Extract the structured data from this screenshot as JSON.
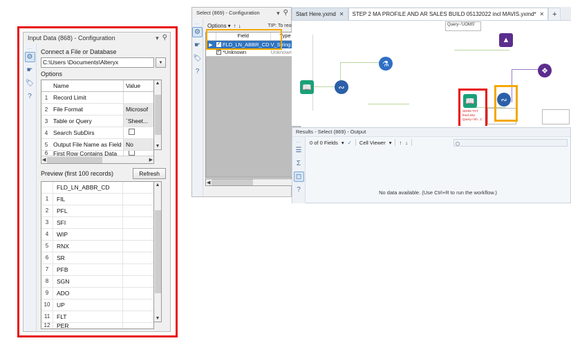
{
  "input_panel": {
    "title": "Input Data (868) - Configuration",
    "section_connect": "Connect a File or Database",
    "file_path": "C:\\Users                \\Documents\\Alteryx",
    "section_options": "Options",
    "options_headers": {
      "num": "",
      "name": "Name",
      "value": "Value"
    },
    "options_rows": [
      {
        "num": "1",
        "name": "Record Limit",
        "value": ""
      },
      {
        "num": "2",
        "name": "File Format",
        "value": "Microsof"
      },
      {
        "num": "3",
        "name": "Table or Query",
        "value": "`Sheet..."
      },
      {
        "num": "4",
        "name": "Search SubDirs",
        "value": "checkbox"
      },
      {
        "num": "5",
        "name": "Output File Name as Field",
        "value": "No"
      },
      {
        "num": "6",
        "name": "First Row Contains Data",
        "value": "checkbox"
      }
    ],
    "preview_label": "Preview (first 100 records)",
    "refresh_label": "Refresh",
    "preview_header": "FLD_LN_ABBR_CD",
    "preview_rows": [
      {
        "num": "1",
        "value": "FIL"
      },
      {
        "num": "2",
        "value": "PFL"
      },
      {
        "num": "3",
        "value": "SFI"
      },
      {
        "num": "4",
        "value": "WIP"
      },
      {
        "num": "5",
        "value": "RNX"
      },
      {
        "num": "6",
        "value": "SR"
      },
      {
        "num": "7",
        "value": "PFB"
      },
      {
        "num": "8",
        "value": "SGN"
      },
      {
        "num": "9",
        "value": "ADO"
      },
      {
        "num": "10",
        "value": "UP"
      },
      {
        "num": "11",
        "value": "FLT"
      },
      {
        "num": "12",
        "value": "PER"
      }
    ],
    "rail_icons": [
      "gear-icon",
      "runtime-icon",
      "annotation-icon",
      "help-icon"
    ]
  },
  "select_panel": {
    "title": "Select (869) - Configuration",
    "options_label": "Options",
    "tip": "TIP: To reorde",
    "headers": {
      "field": "Field",
      "type": "Type"
    },
    "rows": [
      {
        "field": "FLD_LN_ABBR_CD",
        "type": "V_String",
        "checked": true,
        "selected": true
      },
      {
        "field": "*Unknown",
        "type": "Unknown",
        "checked": true,
        "selected": false
      }
    ]
  },
  "tabs": [
    {
      "label": "Start Here.yxmd",
      "active": false
    },
    {
      "label": "STEP 2 MA PROFILE AND AR SALES BUILD 05132022 incl MAVIS.yxmd*",
      "active": true
    }
  ],
  "new_tab_label": "+",
  "canvas": {
    "comment_label": "Query~'UOMS'",
    "annotation_line1": "SDI05 TXT",
    "annotation_line2": "feed.xlsx",
    "annotation_line3": "Query~'Sh...1'"
  },
  "results": {
    "title": "Results - Select (869) - Output",
    "fields_count": "0 of 0 Fields",
    "cell_viewer": "Cell Viewer",
    "search_placeholder": "",
    "no_data": "No data available. (Use Ctrl+R to run the workflow.)"
  },
  "colors": {
    "red_highlight": "#e81010",
    "orange_highlight": "#f5a700",
    "selection_blue": "#2f74c0"
  }
}
